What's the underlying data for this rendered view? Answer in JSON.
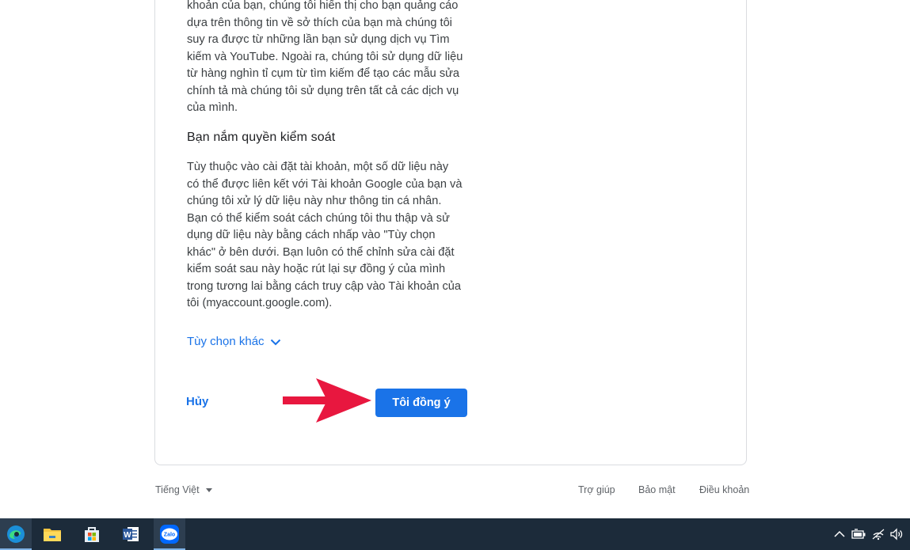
{
  "content": {
    "para1_lines": [
      "khoản của bạn, chúng tôi hiển thị cho bạn quảng cáo",
      "dựa trên thông tin về sở thích của bạn mà chúng tôi",
      "suy ra được từ những lần bạn sử dụng dịch vụ Tìm",
      "kiếm và YouTube. Ngoài ra, chúng tôi sử dụng dữ liệu",
      "từ hàng nghìn tỉ cụm từ tìm kiếm để tạo các mẫu sửa",
      "chính tả mà chúng tôi sử dụng trên tất cả các dịch vụ",
      "của mình."
    ],
    "heading": "Bạn nắm quyền kiểm soát",
    "para2_lines": [
      "Tùy thuộc vào cài đặt tài khoản, một số dữ liệu này",
      "có thể được liên kết với Tài khoản Google của bạn và",
      "chúng tôi xử lý dữ liệu này như thông tin cá nhân.",
      "Bạn có thể kiểm soát cách chúng tôi thu thập và sử",
      "dụng dữ liệu này bằng cách nhấp vào \"Tùy chọn",
      "khác\" ở bên dưới. Bạn luôn có thể chỉnh sửa cài đặt",
      "kiểm soát sau này hoặc rút lại sự đồng ý của mình",
      "trong tương lai bằng cách truy cập vào Tài khoản của",
      "tôi (myaccount.google.com)."
    ],
    "more_options_label": "Tùy chọn khác",
    "cancel_label": "Hủy",
    "agree_label": "Tôi đồng ý"
  },
  "footer": {
    "language": "Tiếng Việt",
    "help": "Trợ giúp",
    "privacy": "Bảo mật",
    "terms": "Điều khoản"
  },
  "colors": {
    "accent": "#1a73e8",
    "annotation_arrow": "#e8173f",
    "taskbar": "#1c2b3a"
  },
  "taskbar": {
    "apps": [
      "edge-icon",
      "file-explorer-icon",
      "microsoft-store-icon",
      "word-icon",
      "zalo-icon"
    ],
    "zalo_label": "Zalo",
    "word_letter": "W"
  }
}
